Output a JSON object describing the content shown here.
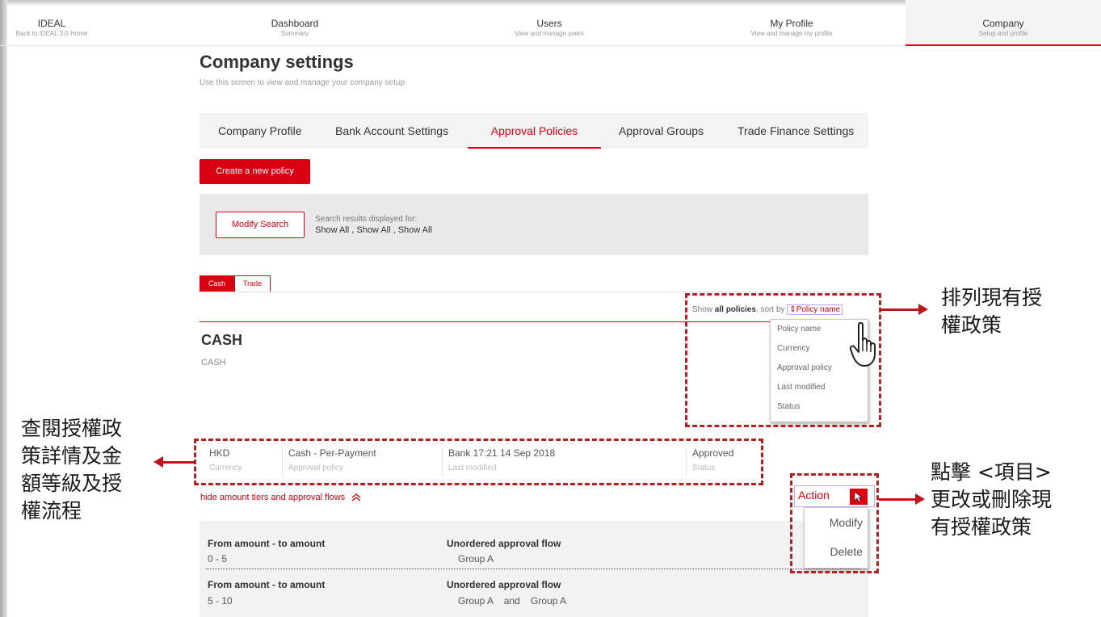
{
  "nav": [
    {
      "title": "IDEAL",
      "sub": "Back to IDEAL 3.0 Home"
    },
    {
      "title": "Dashboard",
      "sub": "Summary"
    },
    {
      "title": "Users",
      "sub": "View and manage users"
    },
    {
      "title": "My Profile",
      "sub": "View and manage my profile"
    },
    {
      "title": "Company",
      "sub": "Setup and profile"
    }
  ],
  "page": {
    "title": "Company settings",
    "subtitle": "Use this screen to view and manage your company setup"
  },
  "tabs": [
    "Company Profile",
    "Bank Account Settings",
    "Approval Policies",
    "Approval Groups",
    "Trade Finance Settings"
  ],
  "active_tab": "Approval Policies",
  "create_button": "Create a new policy",
  "search": {
    "modify_button": "Modify Search",
    "label": "Search results displayed for:",
    "value": "Show All , Show All , Show All"
  },
  "toggle": {
    "cash": "Cash",
    "trade": "Trade"
  },
  "sort": {
    "prefix": "Show",
    "bold": "all policies",
    "mid": ", sort by",
    "arrow": "⇕",
    "link": "Policy name",
    "options": [
      "Policy name",
      "Currency",
      "Approval policy",
      "Last modified",
      "Status"
    ]
  },
  "section": {
    "title": "CASH",
    "subtitle": "CASH"
  },
  "policy": {
    "currency": "HKD",
    "currency_label": "Currency",
    "policy": "Cash - Per-Payment",
    "policy_label": "Approval policy",
    "modified": "Bank 17:21 14 Sep 2018",
    "modified_label": "Last modified",
    "status": "Approved",
    "status_label": "Status"
  },
  "hide_link": "hide amount tiers and approval flows",
  "hide_icon": "double-chevron-up-icon",
  "tiers": [
    {
      "amount_header": "From amount - to amount",
      "amount": "0 - 5",
      "flow_header": "Unordered approval flow",
      "flow": "Group A"
    },
    {
      "amount_header": "From amount - to amount",
      "amount": "5 - 10",
      "flow_header": "Unordered approval flow",
      "flow": "Group A    and    Group A"
    }
  ],
  "action": {
    "label": "Action",
    "icon": "cursor-arrow-icon",
    "items": [
      "Modify",
      "Delete"
    ]
  },
  "annotations": {
    "sort": [
      "排列現有授",
      "權政策"
    ],
    "view": [
      "查閱授權政",
      "策詳情及金",
      "額等級及授",
      "權流程"
    ],
    "action": [
      "點擊 <項目>",
      "更改或刪除現",
      "有授權政策"
    ]
  },
  "colors": {
    "brand_red": "#db0011",
    "annotation_red": "#b51f24"
  }
}
